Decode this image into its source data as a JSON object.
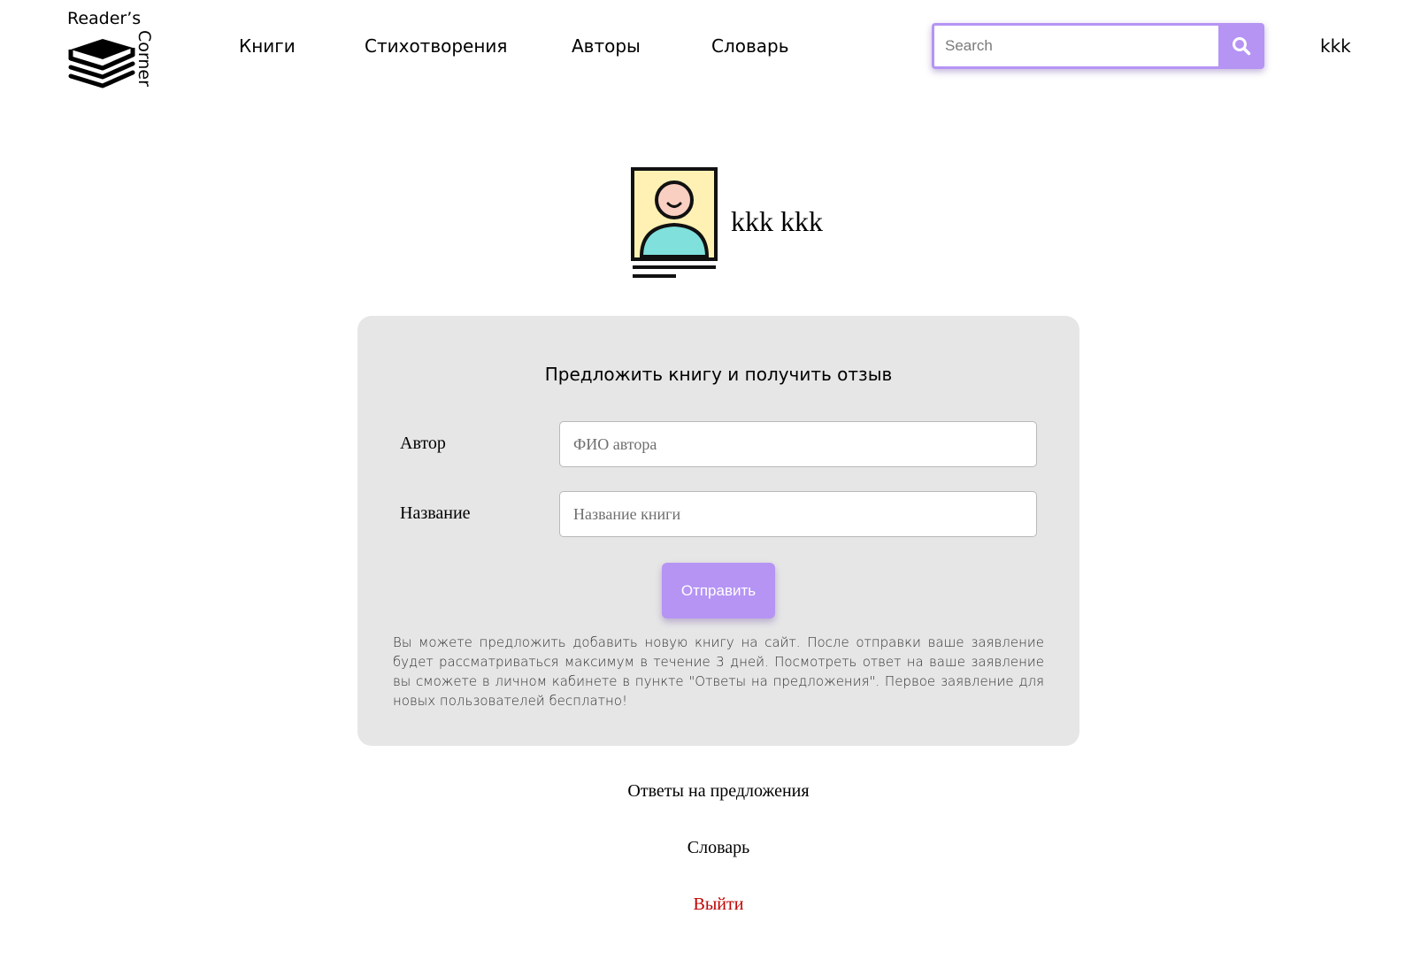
{
  "header": {
    "logo": {
      "line1": "Reader’s",
      "line2": "Corner",
      "icon": "book-stack-icon"
    },
    "nav": [
      {
        "label": "Книги"
      },
      {
        "label": "Стихотворения"
      },
      {
        "label": "Авторы"
      },
      {
        "label": "Словарь"
      }
    ],
    "search": {
      "placeholder": "Search",
      "value": "",
      "icon": "search-icon"
    },
    "username": "kkk"
  },
  "profile": {
    "avatar_icon": "user-portrait-icon",
    "full_name": "kkk kkk"
  },
  "suggest_form": {
    "title": "Предложить книгу и получить отзыв",
    "author": {
      "label": "Автор",
      "placeholder": "ФИО автора",
      "value": ""
    },
    "book": {
      "label": "Название",
      "placeholder": "Название книги",
      "value": ""
    },
    "submit_label": "Отправить",
    "note": "Вы можете предложить добавить новую книгу на сайт. После отправки ваше заявление будет рассматриваться максимум в течение 3 дней. Посмотреть ответ на ваше заявление вы сможете в личном кабинете в пункте \"Ответы на предложения\". Первое заявление для новых пользователей бесплатно!"
  },
  "links": {
    "answers": "Ответы на предложения",
    "dictionary": "Словарь",
    "logout": "Выйти"
  },
  "colors": {
    "accent": "#b594f4",
    "card_bg": "#e6e6e6",
    "logout": "#c00000",
    "avatar_bg": "#fff1b3",
    "avatar_body": "#7fe0dc",
    "avatar_face": "#f9cfc2"
  }
}
